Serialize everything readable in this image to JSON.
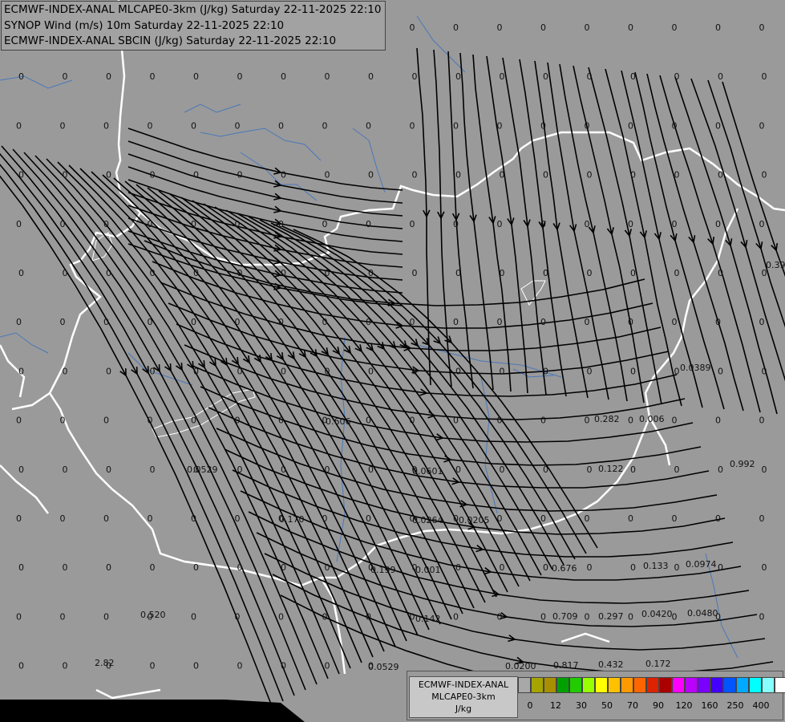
{
  "header": {
    "lines": [
      "ECMWF-INDEX-ANAL MLCAPE0-3km (J/kg) Saturday 22-11-2025 22:10",
      "SYNOP Wind (m/s) 10m Saturday 22-11-2025 22:10",
      "ECMWF-INDEX-ANAL SBCIN (J/kg) Saturday 22-11-2025 22:10"
    ]
  },
  "legend": {
    "label_lines": [
      "ECMWF-INDEX-ANAL",
      "MLCAPE0-3km",
      "J/kg"
    ],
    "colors": [
      "#a8a8a8",
      "#a6a400",
      "#a88f00",
      "#00a000",
      "#22cc00",
      "#98ff00",
      "#ffff00",
      "#ffc000",
      "#ff9900",
      "#ff6600",
      "#dd2200",
      "#aa0000",
      "#ff00ff",
      "#bb00ff",
      "#7a00ff",
      "#4400ff",
      "#0055ff",
      "#00aaff",
      "#00ffff",
      "#88ffff",
      "#ffffff"
    ],
    "ticks": [
      "0",
      "12",
      "30",
      "50",
      "70",
      "90",
      "120",
      "160",
      "250",
      "400"
    ]
  },
  "cin_labels": [
    "0.0389",
    "0.606",
    "0.282",
    "0.006",
    "0.0529",
    "0.122",
    "0.992",
    "0.0601",
    "0.170",
    "0.0264",
    "0.0205",
    "0.676",
    "0.199",
    "0.001",
    "0.133",
    "0.0974",
    "0.520",
    "0.142",
    "0.709",
    "0.297",
    "0.0420",
    "0.0480",
    "2.82",
    "0.0529",
    "0.0200",
    "0.817",
    "0.432",
    "0.172",
    "0.39"
  ],
  "colors": {
    "background": "#9a9a9a",
    "borders": "#ffffff",
    "rivers": "#4a78b8",
    "streamlines": "#000000",
    "sea": "#000000"
  }
}
